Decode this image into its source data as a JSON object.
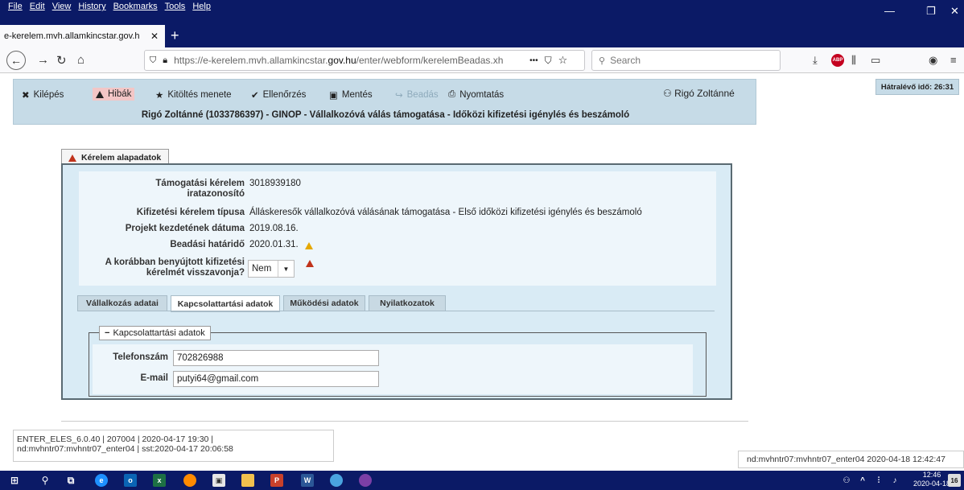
{
  "browser": {
    "menu": [
      "File",
      "Edit",
      "View",
      "History",
      "Bookmarks",
      "Tools",
      "Help"
    ],
    "tab_title": "e-kerelem.mvh.allamkincstar.gov.h",
    "url_prefix": "https://e-kerelem.mvh.allamkincstar.",
    "url_domain": "gov.hu",
    "url_path": "/enter/webform/kerelemBeadas.xh",
    "url_more": "•••",
    "search_placeholder": "Search",
    "abp_label": "ABP"
  },
  "toolbar": {
    "exit": "Kilépés",
    "errors": "Hibák",
    "process": "Kitöltés menete",
    "check": "Ellenőrzés",
    "save": "Mentés",
    "submit": "Beadás",
    "print": "Nyomtatás",
    "user": "Rigó Zoltánné",
    "timer": "Hátralévő idő: 26:31"
  },
  "header_title": "Rigó Zoltánné (1033786397) - GINOP - Vállalkozóvá válás támogatása - Időközi kifizetési igénylés és beszámoló",
  "main_tab": "Kérelem alapadatok",
  "info": {
    "id_label_1": "Támogatási kérelem",
    "id_label_2": "iratazonosító",
    "id_value": "3018939180",
    "type_label": "Kifizetési kérelem típusa",
    "type_value": "Álláskeresők vállalkozóvá válásának támogatása - Első időközi kifizetési igénylés és beszámoló",
    "start_label": "Projekt kezdetének dátuma",
    "start_value": "2019.08.16.",
    "deadline_label": "Beadási határidő",
    "deadline_value": "2020.01.31.",
    "withdraw_label_1": "A korábban benyújtott kifizetési",
    "withdraw_label_2": "kérelmét visszavonja?",
    "withdraw_value": "Nem"
  },
  "subtabs": [
    "Vállalkozás adatai",
    "Kapcsolattartási adatok",
    "Működési adatok",
    "Nyilatkozatok"
  ],
  "contact": {
    "legend": "Kapcsolattartási adatok",
    "phone_label": "Telefonszám",
    "phone_value": "702826988",
    "email_label": "E-mail",
    "email_value": "putyi64@gmail.com"
  },
  "footer": {
    "line1": "ENTER_ELES_6.0.40 | 207004 | 2020-04-17 19:30 |",
    "line2": "nd:mvhntr07:mvhntr07_enter04 | sst:2020-04-17 20:06:58",
    "node": "nd:mvhntr07:mvhntr07_enter04  2020-04-18 12:42:47"
  },
  "taskbar": {
    "time": "12:46",
    "date": "2020-04-18",
    "notif_count": "16"
  }
}
